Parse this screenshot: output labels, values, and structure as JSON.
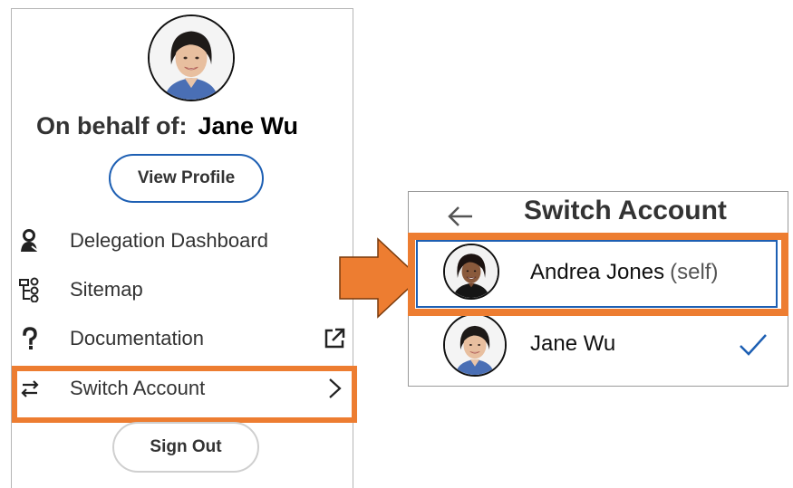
{
  "profile": {
    "on_behalf_label": "On behalf of:",
    "name": "Jane Wu",
    "view_profile_label": "View Profile"
  },
  "menu": {
    "items": [
      {
        "label": "Delegation Dashboard",
        "icon": "person-icon"
      },
      {
        "label": "Sitemap",
        "icon": "sitemap-icon"
      },
      {
        "label": "Documentation",
        "icon": "question-icon",
        "trailing_icon": "external-link-icon"
      },
      {
        "label": "Switch Account",
        "icon": "switch-arrows-icon",
        "trailing_icon": "chevron-right-icon"
      }
    ],
    "sign_out_label": "Sign Out"
  },
  "switch_account": {
    "title": "Switch Account",
    "accounts": [
      {
        "name": "Andrea Jones",
        "suffix": "(self)",
        "selected": false
      },
      {
        "name": "Jane Wu",
        "suffix": "",
        "selected": true
      }
    ]
  },
  "colors": {
    "highlight": "#ed7d31",
    "accent_blue": "#1d5fb3",
    "text": "#333333"
  }
}
